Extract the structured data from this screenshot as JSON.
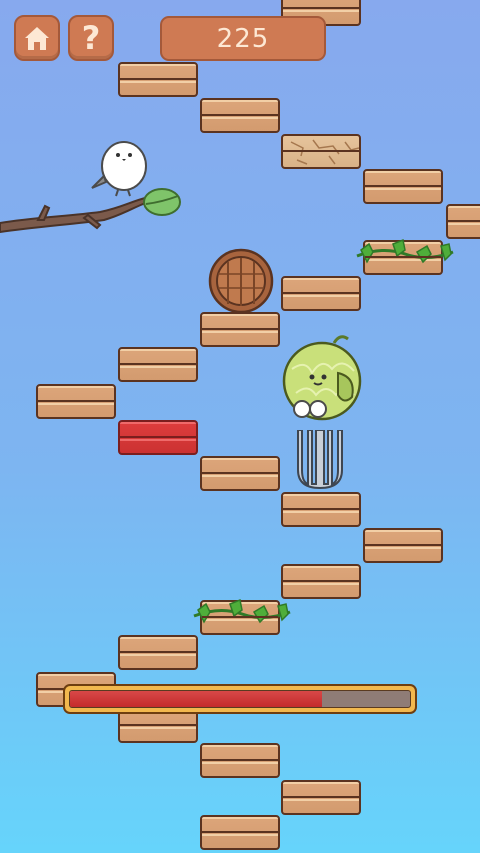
{
  "hud": {
    "home_icon": "home-icon",
    "help_label": "?",
    "score": "225"
  },
  "progress": {
    "value": 0.74
  },
  "colors": {
    "sky_top": "#87a9ee",
    "sky_bottom": "#66d4fb",
    "hud_button": "#cf7a53",
    "platform_wood": "#d9a173",
    "platform_red": "#d83a3a",
    "progress_fill": "#c42b2b",
    "progress_frame": "#f2b84e"
  },
  "characters": {
    "player": "melon-character",
    "bird": "white-bird",
    "hazard": "fork"
  }
}
